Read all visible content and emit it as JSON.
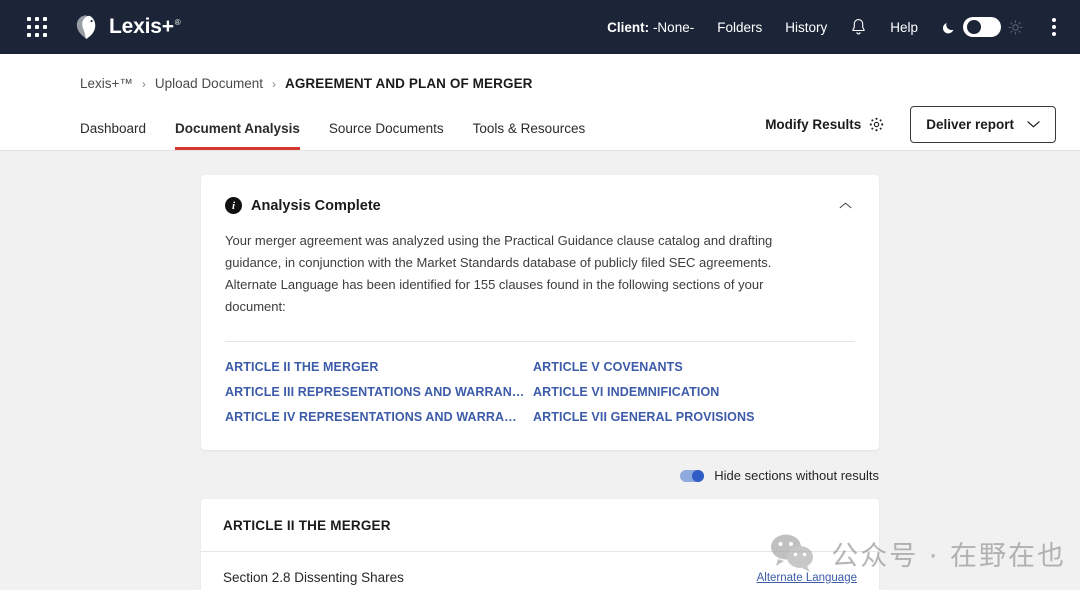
{
  "colors": {
    "header_bg": "#1b2537",
    "accent_red": "#d6382f",
    "link_blue": "#3c5ba9",
    "toggle_blue": "#2f5cc5",
    "page_bg": "#f1f1f1"
  },
  "topbar": {
    "app_grid_icon": "app-grid-icon",
    "logo_icon": "lexis-eagle-logo-icon",
    "brand": "Lexis+",
    "brand_tm": "®",
    "client_label": "Client:",
    "client_value": "-None-",
    "folders": "Folders",
    "history": "History",
    "notification_icon": "bell-icon",
    "help": "Help",
    "moon_icon": "moon-icon",
    "sun_icon": "sun-icon",
    "theme_toggle_state": "dark",
    "kebab_icon": "more-options-icon"
  },
  "breadcrumb": {
    "items": [
      {
        "label": "Lexis+™",
        "current": false
      },
      {
        "label": "Upload Document",
        "current": false
      },
      {
        "label": "AGREEMENT AND PLAN OF MERGER",
        "current": true
      }
    ],
    "separator": "›"
  },
  "tabs": [
    {
      "label": "Dashboard",
      "active": false
    },
    {
      "label": "Document Analysis",
      "active": true
    },
    {
      "label": "Source Documents",
      "active": false
    },
    {
      "label": "Tools & Resources",
      "active": false
    }
  ],
  "actions": {
    "modify_results": "Modify Results",
    "modify_results_icon": "gear-icon",
    "deliver_report": "Deliver report",
    "deliver_chevron_icon": "chevron-down-icon"
  },
  "analysis_card": {
    "info_icon": "info-icon",
    "info_glyph": "i",
    "title": "Analysis Complete",
    "collapse_icon": "chevron-up-icon",
    "paragraph": "Your merger agreement was analyzed using the Practical Guidance clause catalog and drafting guidance, in conjunction with the Market Standards database of publicly filed SEC agreements. Alternate Language has been identified for 155 clauses found in the following sections of your document:",
    "clause_count": "155",
    "links": [
      "ARTICLE II THE MERGER",
      "ARTICLE V COVENANTS",
      "ARTICLE III REPRESENTATIONS AND WARRANTI...",
      "ARTICLE VI INDEMNIFICATION",
      "ARTICLE IV REPRESENTATIONS AND WARRANTI...",
      "ARTICLE VII GENERAL PROVISIONS"
    ]
  },
  "hide_sections": {
    "label": "Hide sections without results",
    "state": "on"
  },
  "results": {
    "section_title": "ARTICLE II THE MERGER",
    "rows": [
      {
        "title": "Section 2.8 Dissenting Shares",
        "action": "Alternate Language"
      }
    ]
  },
  "watermark": {
    "icon": "wechat-icon",
    "text": "公众号 · 在野在也"
  }
}
